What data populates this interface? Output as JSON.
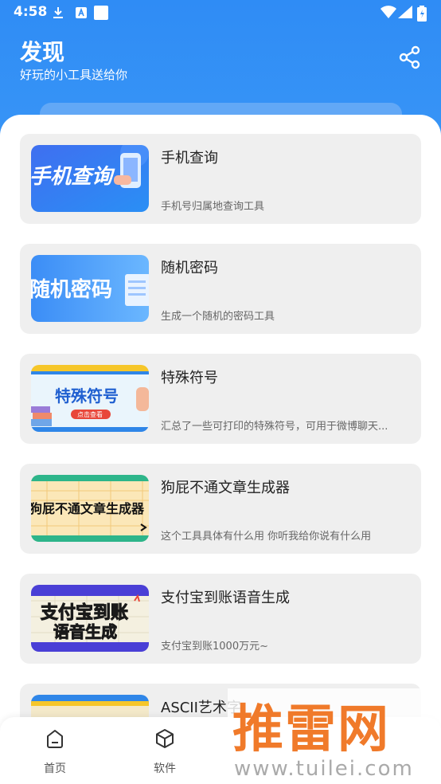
{
  "status_bar": {
    "time": "4:58"
  },
  "header": {
    "title": "发现",
    "subtitle": "好玩的小工具送给你",
    "share_icon": "share-icon"
  },
  "tools": [
    {
      "title": "手机查询",
      "desc": "手机号归属地查询工具",
      "thumb_text": "手机查询"
    },
    {
      "title": "随机密码",
      "desc": "生成一个随机的密码工具",
      "thumb_text": "随机密码"
    },
    {
      "title": "特殊符号",
      "desc": "汇总了一些可打印的特殊符号，可用于微博聊天...",
      "thumb_text": "特殊符号",
      "thumb_sub": "点击查看"
    },
    {
      "title": "狗屁不通文章生成器",
      "desc": "这个工具具体有什么用 你听我给你说有什么用",
      "thumb_text": "狗屁不通文章生成器"
    },
    {
      "title": "支付宝到账语音生成",
      "desc": "支付宝到账1000万元~",
      "thumb_text_1": "支付宝到账",
      "thumb_text_2": "语音生成"
    },
    {
      "title": "ASCII艺术字",
      "desc": ""
    }
  ],
  "bottom_nav": [
    {
      "label": "首页",
      "icon": "home-icon"
    },
    {
      "label": "软件",
      "icon": "cube-icon"
    }
  ],
  "watermark": {
    "main": "推雷网",
    "url": "www.tuilei.com"
  },
  "colors": {
    "primary": "#2f8cf5",
    "card_bg": "#efefef",
    "watermark": "#f07a2a"
  }
}
